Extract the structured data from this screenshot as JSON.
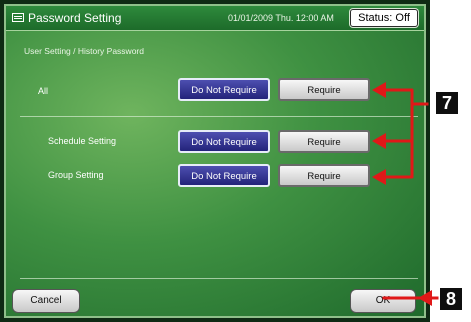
{
  "window": {
    "title": "Password Setting",
    "datetime": "01/01/2009 Thu. 12:00 AM",
    "status": "Status: Off"
  },
  "section_label": "User Setting / History Password",
  "rows": [
    {
      "label": "All",
      "selected_option": "Do Not Require",
      "other_option": "Require"
    },
    {
      "label": "Schedule Setting",
      "selected_option": "Do Not Require",
      "other_option": "Require"
    },
    {
      "label": "Group Setting",
      "selected_option": "Do Not Require",
      "other_option": "Require"
    }
  ],
  "footer": {
    "cancel_label": "Cancel",
    "ok_label": "OK"
  },
  "callouts": [
    "7",
    "8"
  ],
  "colors": {
    "arrow": "#e01818",
    "selected_button": "#2c2c8a",
    "panel": "#3f9142"
  },
  "icons": {
    "title_icon": "window-icon"
  }
}
